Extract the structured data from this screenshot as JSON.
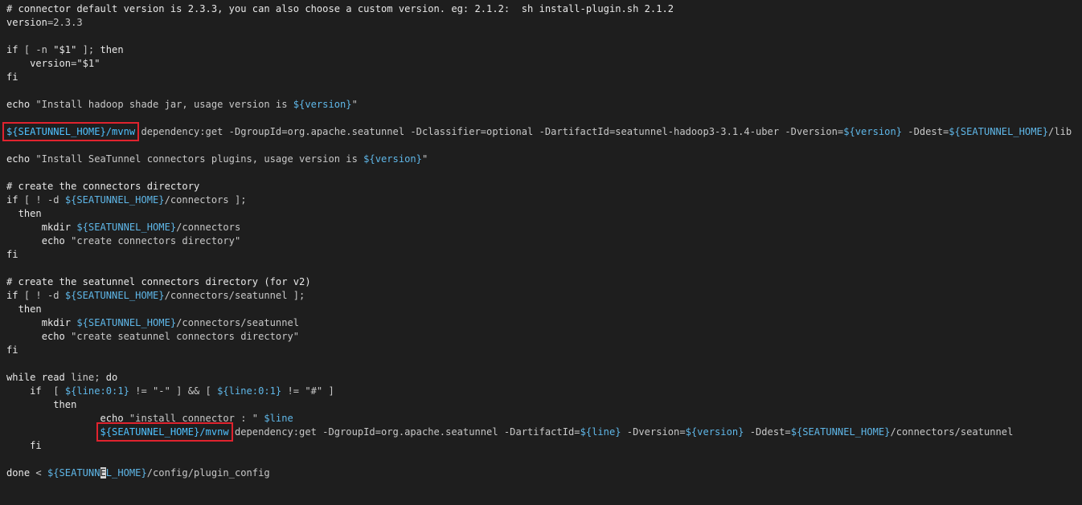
{
  "editor": {
    "language": "shell",
    "colors": {
      "background": "#1e1e1e",
      "text": "#d4d4d4",
      "variable": "#5fb7e8",
      "highlight_box": "#e0232e"
    },
    "lines": [
      {
        "indent": "",
        "tokens": [
          {
            "t": "# connector default version is 2.3.3, you can also choose a custom version. eg: 2.1.2:  sh install-plugin.sh 2.1.2",
            "c": "comment"
          }
        ]
      },
      {
        "indent": "",
        "tokens": [
          {
            "t": "version",
            "c": "white"
          },
          {
            "t": "=2.3.3",
            "c": "str"
          }
        ]
      },
      {
        "indent": "",
        "tokens": []
      },
      {
        "indent": "",
        "tokens": [
          {
            "t": "if",
            "c": "kw"
          },
          {
            "t": " [ -n ",
            "c": "str"
          },
          {
            "t": "\"$1\"",
            "c": "white"
          },
          {
            "t": " ]; ",
            "c": "str"
          },
          {
            "t": "then",
            "c": "kw"
          }
        ]
      },
      {
        "indent": "    ",
        "tokens": [
          {
            "t": "version",
            "c": "white"
          },
          {
            "t": "=",
            "c": "str"
          },
          {
            "t": "\"$1\"",
            "c": "white"
          }
        ]
      },
      {
        "indent": "",
        "tokens": [
          {
            "t": "fi",
            "c": "kw"
          }
        ]
      },
      {
        "indent": "",
        "tokens": []
      },
      {
        "indent": "",
        "tokens": [
          {
            "t": "echo",
            "c": "white"
          },
          {
            "t": " \"Install hadoop shade jar, usage version is ",
            "c": "str"
          },
          {
            "t": "${version}",
            "c": "var"
          },
          {
            "t": "\"",
            "c": "str"
          }
        ]
      },
      {
        "indent": "",
        "tokens": []
      },
      {
        "indent": "",
        "tokens": [
          {
            "t": "${SEATUNNEL_HOME}/mvnw",
            "c": "hi"
          },
          {
            "t": " dependency:get -DgroupId=org.apache.seatunnel -Dclassifier=optional -DartifactId=seatunnel-hadoop3-3.1.4-uber -Dversion=",
            "c": "str"
          },
          {
            "t": "${version}",
            "c": "var"
          },
          {
            "t": " -Ddest=",
            "c": "str"
          },
          {
            "t": "${SEATUNNEL_HOME}",
            "c": "var"
          },
          {
            "t": "/lib",
            "c": "str"
          }
        ]
      },
      {
        "indent": "",
        "tokens": []
      },
      {
        "indent": "",
        "tokens": [
          {
            "t": "echo",
            "c": "white"
          },
          {
            "t": " \"Install SeaTunnel connectors plugins, usage version is ",
            "c": "str"
          },
          {
            "t": "${version}",
            "c": "var"
          },
          {
            "t": "\"",
            "c": "str"
          }
        ]
      },
      {
        "indent": "",
        "tokens": []
      },
      {
        "indent": "",
        "tokens": [
          {
            "t": "# create the connectors directory",
            "c": "comment"
          }
        ]
      },
      {
        "indent": "",
        "tokens": [
          {
            "t": "if",
            "c": "kw"
          },
          {
            "t": " [ ! -d ",
            "c": "str"
          },
          {
            "t": "${SEATUNNEL_HOME}",
            "c": "var"
          },
          {
            "t": "/connectors ];",
            "c": "str"
          }
        ]
      },
      {
        "indent": "  ",
        "tokens": [
          {
            "t": "then",
            "c": "kw"
          }
        ]
      },
      {
        "indent": "      ",
        "tokens": [
          {
            "t": "mkdir",
            "c": "white"
          },
          {
            "t": " ",
            "c": "str"
          },
          {
            "t": "${SEATUNNEL_HOME}",
            "c": "var"
          },
          {
            "t": "/connectors",
            "c": "str"
          }
        ]
      },
      {
        "indent": "      ",
        "tokens": [
          {
            "t": "echo",
            "c": "white"
          },
          {
            "t": " \"create connectors directory\"",
            "c": "str"
          }
        ]
      },
      {
        "indent": "",
        "tokens": [
          {
            "t": "fi",
            "c": "kw"
          }
        ]
      },
      {
        "indent": "",
        "tokens": []
      },
      {
        "indent": "",
        "tokens": [
          {
            "t": "# create the seatunnel connectors directory (for v2)",
            "c": "comment"
          }
        ]
      },
      {
        "indent": "",
        "tokens": [
          {
            "t": "if",
            "c": "kw"
          },
          {
            "t": " [ ! -d ",
            "c": "str"
          },
          {
            "t": "${SEATUNNEL_HOME}",
            "c": "var"
          },
          {
            "t": "/connectors/seatunnel ];",
            "c": "str"
          }
        ]
      },
      {
        "indent": "  ",
        "tokens": [
          {
            "t": "then",
            "c": "kw"
          }
        ]
      },
      {
        "indent": "      ",
        "tokens": [
          {
            "t": "mkdir",
            "c": "white"
          },
          {
            "t": " ",
            "c": "str"
          },
          {
            "t": "${SEATUNNEL_HOME}",
            "c": "var"
          },
          {
            "t": "/connectors/seatunnel",
            "c": "str"
          }
        ]
      },
      {
        "indent": "      ",
        "tokens": [
          {
            "t": "echo",
            "c": "white"
          },
          {
            "t": " \"create seatunnel connectors directory\"",
            "c": "str"
          }
        ]
      },
      {
        "indent": "",
        "tokens": [
          {
            "t": "fi",
            "c": "kw"
          }
        ]
      },
      {
        "indent": "",
        "tokens": []
      },
      {
        "indent": "",
        "tokens": [
          {
            "t": "while",
            "c": "kw"
          },
          {
            "t": " ",
            "c": "str"
          },
          {
            "t": "read",
            "c": "white"
          },
          {
            "t": " line; ",
            "c": "str"
          },
          {
            "t": "do",
            "c": "kw"
          }
        ]
      },
      {
        "indent": "    ",
        "tokens": [
          {
            "t": "if",
            "c": "kw"
          },
          {
            "t": "  [ ",
            "c": "str"
          },
          {
            "t": "${line:0:1}",
            "c": "var"
          },
          {
            "t": " != \"-\" ] && [ ",
            "c": "str"
          },
          {
            "t": "${line:0:1}",
            "c": "var"
          },
          {
            "t": " != \"#\" ]",
            "c": "str"
          }
        ]
      },
      {
        "indent": "        ",
        "tokens": [
          {
            "t": "then",
            "c": "kw"
          }
        ]
      },
      {
        "indent": "                ",
        "tokens": [
          {
            "t": "echo",
            "c": "white"
          },
          {
            "t": " \"install connector : \" ",
            "c": "str"
          },
          {
            "t": "$line",
            "c": "var"
          }
        ]
      },
      {
        "indent": "                ",
        "tokens": [
          {
            "t": "${SEATUNNEL_HOME}/mvnw",
            "c": "hi"
          },
          {
            "t": " dependency:get -DgroupId=org.apache.seatunnel -DartifactId=",
            "c": "str"
          },
          {
            "t": "${line}",
            "c": "var"
          },
          {
            "t": " -Dversion=",
            "c": "str"
          },
          {
            "t": "${version}",
            "c": "var"
          },
          {
            "t": " -Ddest=",
            "c": "str"
          },
          {
            "t": "${SEATUNNEL_HOME}",
            "c": "var"
          },
          {
            "t": "/connectors/seatunnel",
            "c": "str"
          }
        ]
      },
      {
        "indent": "    ",
        "tokens": [
          {
            "t": "fi",
            "c": "kw"
          }
        ]
      },
      {
        "indent": "",
        "tokens": []
      },
      {
        "indent": "",
        "tokens": [
          {
            "t": "done",
            "c": "kw"
          },
          {
            "t": " < ",
            "c": "str"
          },
          {
            "t": "${SEATUNN",
            "c": "var"
          },
          {
            "t": "E",
            "c": "cursor"
          },
          {
            "t": "L_HOME}",
            "c": "var"
          },
          {
            "t": "/config/plugin_config",
            "c": "str"
          }
        ]
      }
    ]
  }
}
